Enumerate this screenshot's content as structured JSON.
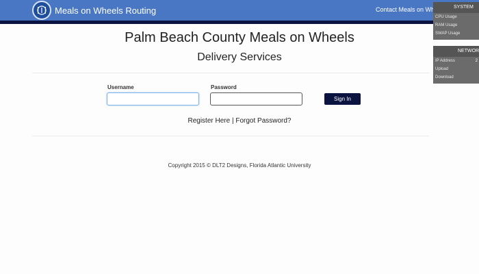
{
  "navbar": {
    "brand": "Meals on Wheels Routing",
    "contact_link": "Contact Meals on Wheels",
    "logo_icon": "utensils-plate-icon"
  },
  "header": {
    "title": "Palm Beach County Meals on Wheels",
    "subtitle": "Delivery Services"
  },
  "login_form": {
    "username_label": "Username",
    "username_value": "",
    "password_label": "Password",
    "password_value": "",
    "sign_in_label": "Sign In"
  },
  "links": {
    "register": "Register Here",
    "separator": " | ",
    "forgot": "Forgot Password?"
  },
  "footer": {
    "copyright": "Copyright 2015 © DLT2 Designs, Florida Atlantic University"
  },
  "system_widget": {
    "title": "SYSTEM",
    "rows": [
      "CPU Usage",
      "RAM Usage",
      "SWAP Usage"
    ]
  },
  "network_widget": {
    "title": "NETWORK",
    "rows": [
      "IP Address",
      "Upload",
      "Download"
    ],
    "ip_value_partial": "2"
  },
  "colors": {
    "navbar": "#4a77c4",
    "navbar_accent": "#0b1440",
    "button": "#0b1440"
  }
}
